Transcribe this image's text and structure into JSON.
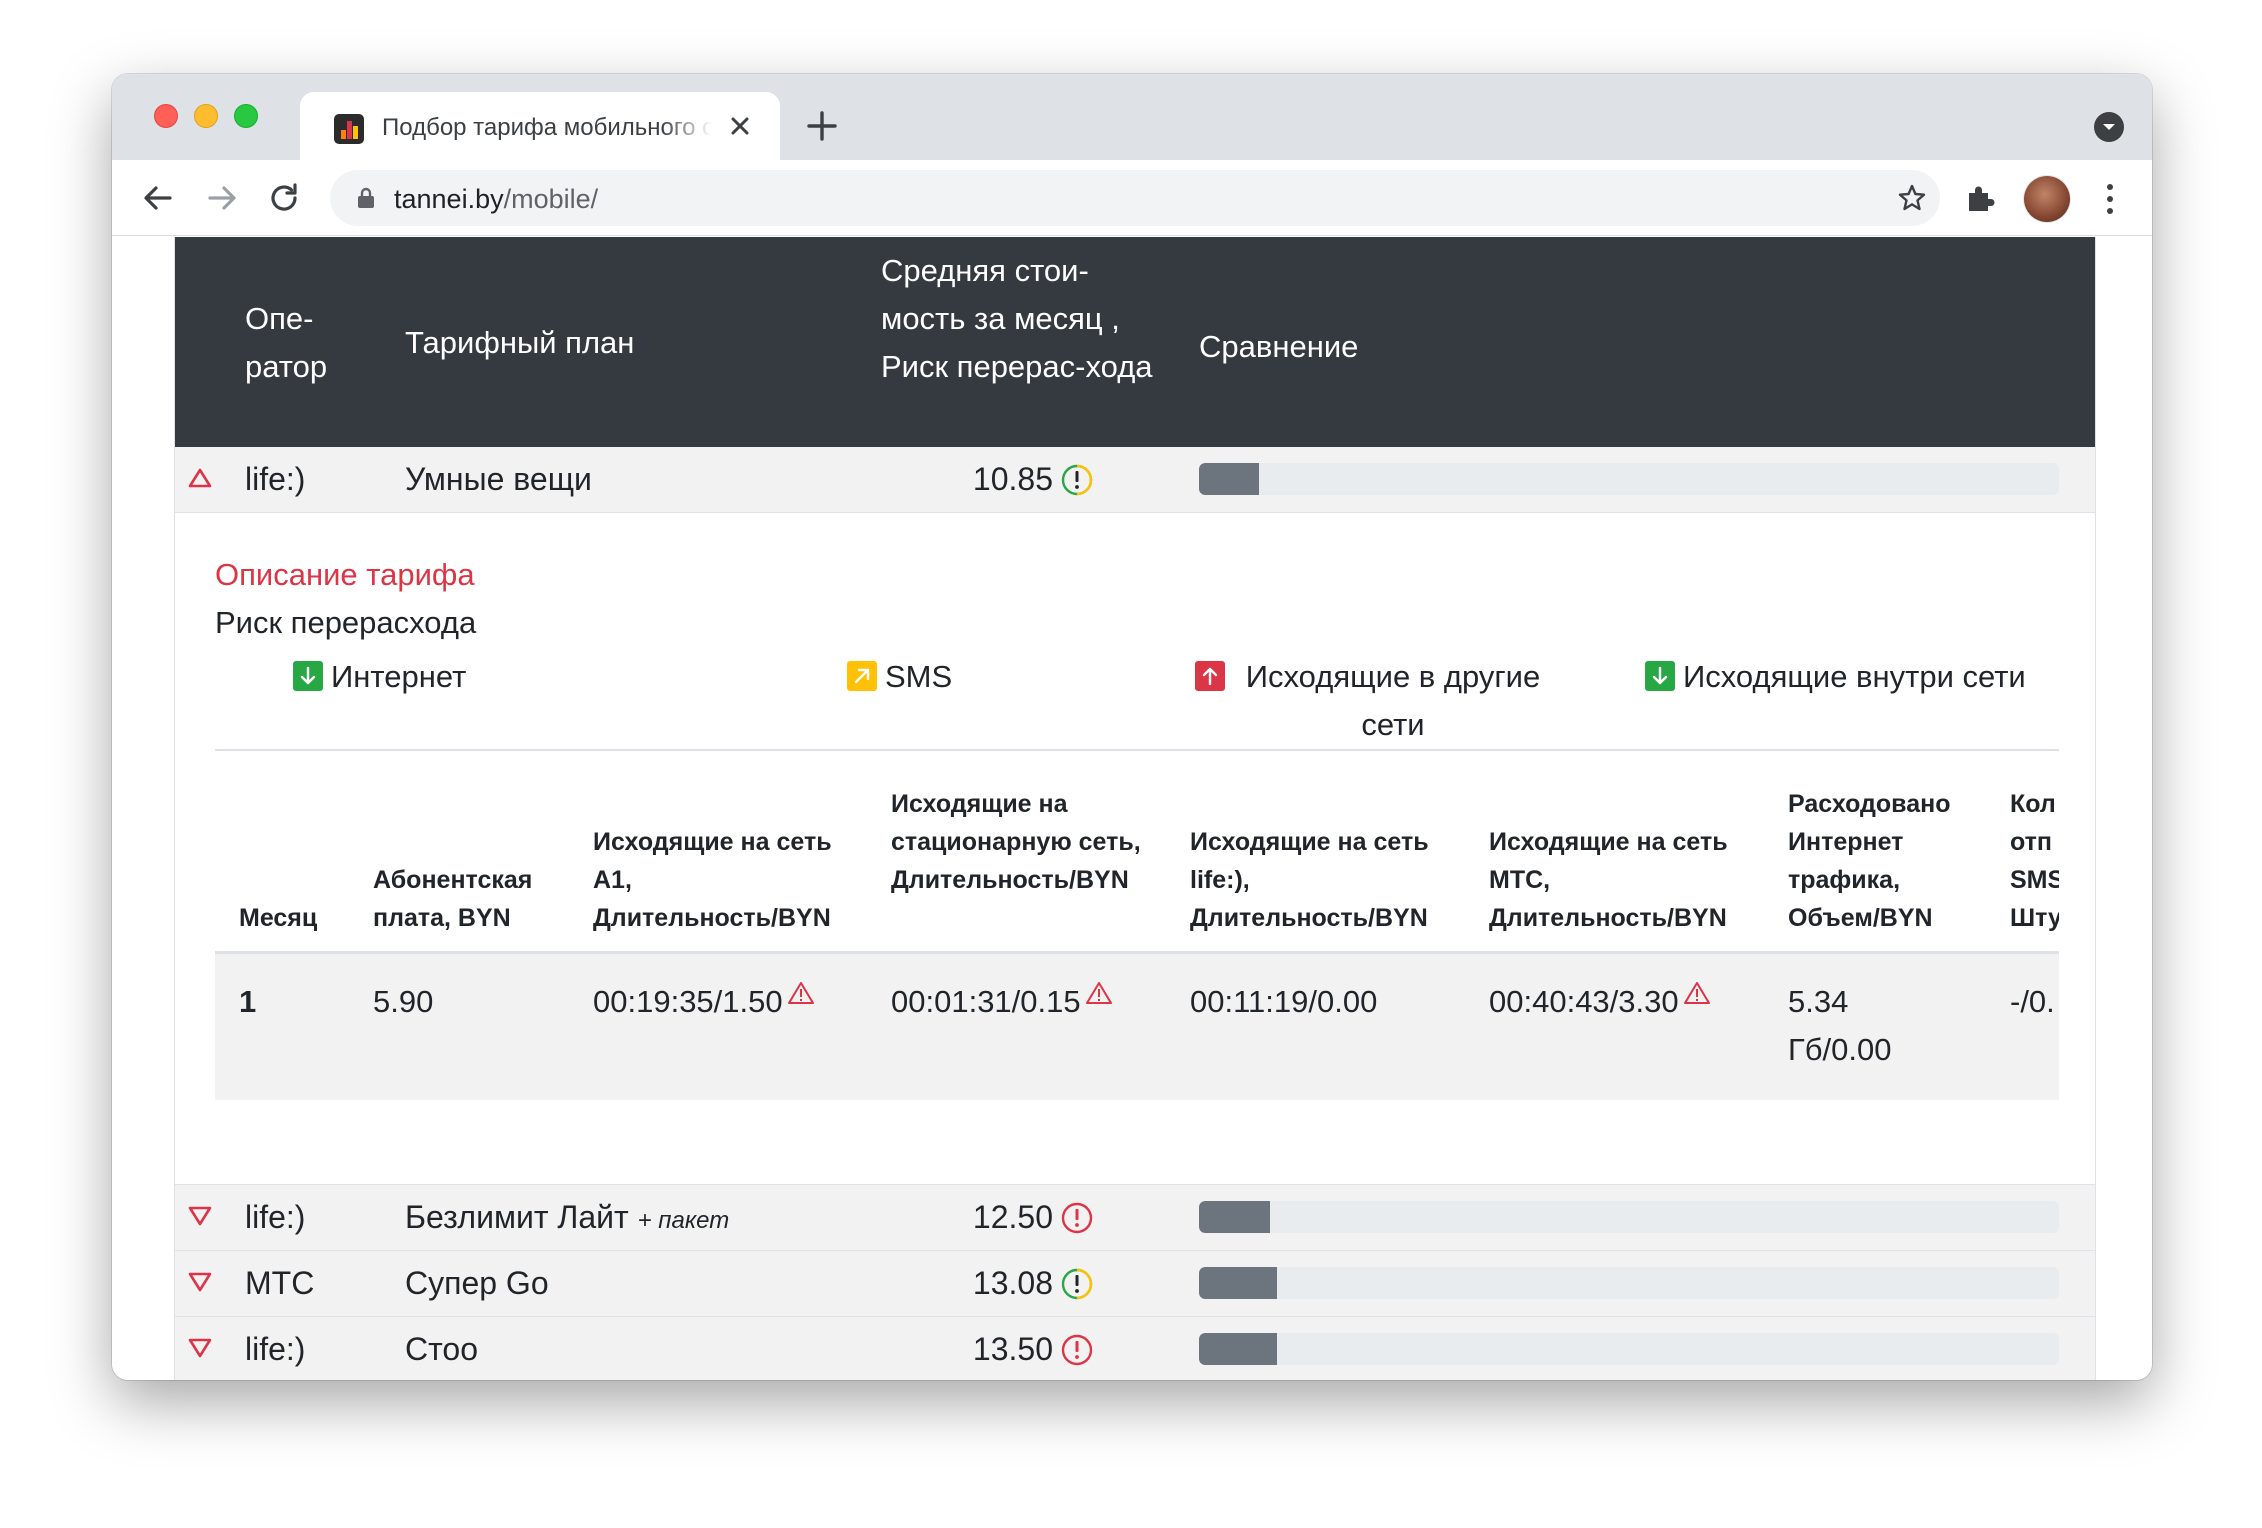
{
  "browser": {
    "tab_title": "Подбор тарифа мобильного о",
    "url_host": "tannei.by",
    "url_path": "/mobile/"
  },
  "colors": {
    "header_bg": "#343a40",
    "danger": "#dc3545",
    "warning": "#ffc107",
    "success": "#28a745",
    "bar_fill": "#6c757d"
  },
  "table": {
    "headers": {
      "operator": "Опе-ратор",
      "plan": "Тарифный план",
      "cost": "Средняя стои-мость за месяц , Риск перерас-хода",
      "compare": "Сравнение"
    },
    "rows": [
      {
        "operator": "life:)",
        "plan": "Умные вещи",
        "plan_suffix": "",
        "cost": "10.85",
        "risk": "yellow",
        "bar_fraction": 0.07,
        "expanded": true
      },
      {
        "operator": "life:)",
        "plan": "Безлимит Лайт",
        "plan_suffix": "+ пакет",
        "cost": "12.50",
        "risk": "red",
        "bar_fraction": 0.082,
        "expanded": false
      },
      {
        "operator": "МТС",
        "plan": "Супер Go",
        "plan_suffix": "",
        "cost": "13.08",
        "risk": "yellow",
        "bar_fraction": 0.091,
        "expanded": false
      },
      {
        "operator": "life:)",
        "plan": "Стоо",
        "plan_suffix": "",
        "cost": "13.50",
        "risk": "red",
        "bar_fraction": 0.091,
        "expanded": false
      }
    ]
  },
  "detail": {
    "description_title": "Описание тарифа",
    "risk_title": "Риск перерасхода",
    "risk_items": [
      {
        "label": "Интернет",
        "level": "down-green"
      },
      {
        "label": "SMS",
        "level": "diag-yellow"
      },
      {
        "label": "Исходящие в другие сети",
        "level": "up-red"
      },
      {
        "label": "Исходящие внутри сети",
        "level": "down-green"
      }
    ],
    "columns": [
      "Месяц",
      "Абонентская плата, BYN",
      "Исходящие на сеть А1, Длительность/BYN",
      "Исходящие на стационарную сеть, Длительность/BYN",
      "Исходящие на сеть life:), Длительность/BYN",
      "Исходящие на сеть МТС, Длительность/BYN",
      "Расходовано Интернет трафика, Объем/BYN",
      "Кол отп SMS Шту"
    ],
    "row": {
      "month": "1",
      "fee": "5.90",
      "a1": "00:19:35/1.50",
      "landline": "00:01:31/0.15",
      "life": "00:11:19/0.00",
      "mts": "00:40:43/3.30",
      "internet": "5.34 Гб/0.00",
      "sms": "-/0."
    }
  }
}
